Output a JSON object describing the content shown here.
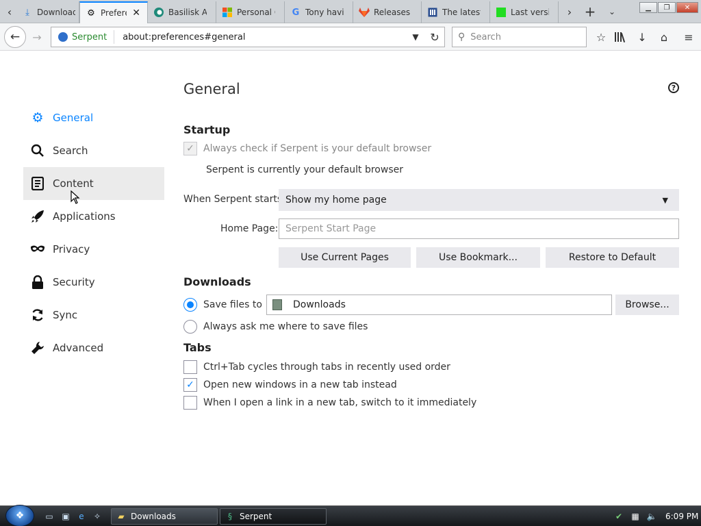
{
  "tabs": [
    {
      "label": "Download",
      "icon": "download-arrow-icon"
    },
    {
      "label": "Prefere",
      "icon": "gear-icon"
    },
    {
      "label": "Basilisk An",
      "icon": "basilisk-icon"
    },
    {
      "label": "Personal C",
      "icon": "windows-logo-icon"
    },
    {
      "label": "Tony havil",
      "icon": "google-icon"
    },
    {
      "label": "Releases",
      "icon": "gitlab-icon"
    },
    {
      "label": "The latest",
      "icon": "document-icon"
    },
    {
      "label": "Last versio",
      "icon": "green-square-icon"
    }
  ],
  "urlbar": {
    "identity": "Serpent",
    "url": "about:preferences#general"
  },
  "search": {
    "placeholder": "Search"
  },
  "sidebar": {
    "items": [
      {
        "label": "General",
        "icon": "gear-icon"
      },
      {
        "label": "Search",
        "icon": "search-icon"
      },
      {
        "label": "Content",
        "icon": "document-icon"
      },
      {
        "label": "Applications",
        "icon": "rocket-icon"
      },
      {
        "label": "Privacy",
        "icon": "mask-icon"
      },
      {
        "label": "Security",
        "icon": "lock-icon"
      },
      {
        "label": "Sync",
        "icon": "sync-icon"
      },
      {
        "label": "Advanced",
        "icon": "wrench-icon"
      }
    ]
  },
  "page": {
    "title": "General",
    "help": "?"
  },
  "startup": {
    "heading": "Startup",
    "default_check_label": "Always check if Serpent is your default browser",
    "default_status": "Serpent is currently your default browser",
    "when_starts_label": "When Serpent starts:",
    "when_starts_value": "Show my home page",
    "home_page_label": "Home Page:",
    "home_page_placeholder": "Serpent Start Page",
    "use_current_pages": "Use Current Pages",
    "use_bookmark": "Use Bookmark...",
    "restore_default": "Restore to Default"
  },
  "downloads": {
    "heading": "Downloads",
    "save_files_label": "Save files to",
    "folder": "Downloads",
    "browse": "Browse...",
    "always_ask_label": "Always ask me where to save files"
  },
  "tabs_section": {
    "heading": "Tabs",
    "ctrl_tab": "Ctrl+Tab cycles through tabs in recently used order",
    "open_new_windows": "Open new windows in a new tab instead",
    "switch_immediately": "When I open a link in a new tab, switch to it immediately"
  },
  "taskbar": {
    "tasks": [
      {
        "label": "Downloads",
        "icon": "folder-icon"
      },
      {
        "label": "Serpent",
        "icon": "serpent-icon"
      }
    ],
    "clock": "6:09 PM"
  },
  "colors": {
    "accent": "#0a84ff",
    "tabbar": "#cfd3d7",
    "taskbar": "#15181b"
  }
}
